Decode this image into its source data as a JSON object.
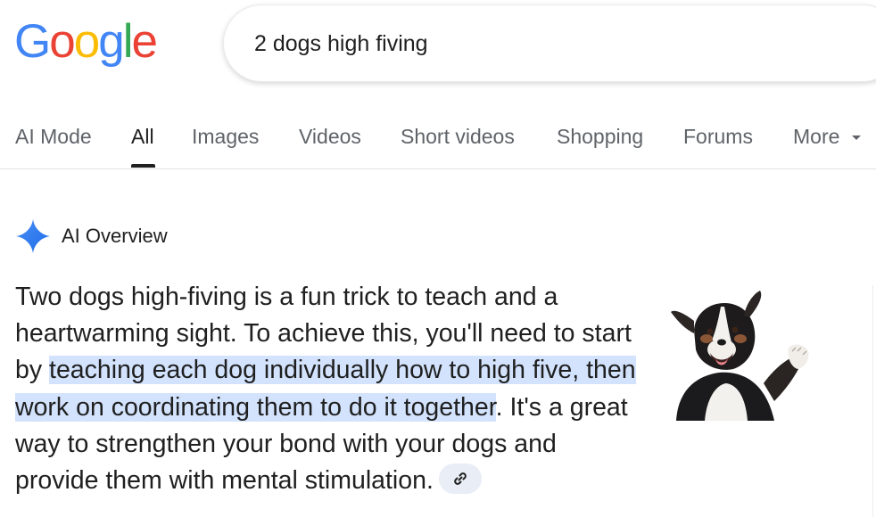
{
  "logo": {
    "letters": [
      "G",
      "o",
      "o",
      "g",
      "l",
      "e"
    ],
    "colors": [
      "#4285F4",
      "#EA4335",
      "#FBBC05",
      "#4285F4",
      "#34A853",
      "#EA4335"
    ]
  },
  "search": {
    "query": "2 dogs high fiving"
  },
  "tabs": [
    {
      "label": "AI Mode"
    },
    {
      "label": "All"
    },
    {
      "label": "Images"
    },
    {
      "label": "Videos"
    },
    {
      "label": "Short videos"
    },
    {
      "label": "Shopping"
    },
    {
      "label": "Forums"
    },
    {
      "label": "More"
    }
  ],
  "active_tab": "All",
  "ai_overview": {
    "title": "AI Overview",
    "text_before": "Two dogs high-fiving is a fun trick to teach and a heartwarming sight. To achieve this, you'll need to start by ",
    "text_highlight": "teaching each dog individually how to high five, then work on coordinating them to do it together",
    "text_after": ". It's a great way to strengthen your bond with your dogs and provide them with mental stimulation.",
    "link_icon": "link-icon",
    "image": "dog-high-five-photo"
  },
  "colors": {
    "accent": "#4285F4",
    "highlight": "#d3e3fd",
    "tab_text": "#5f6368"
  }
}
